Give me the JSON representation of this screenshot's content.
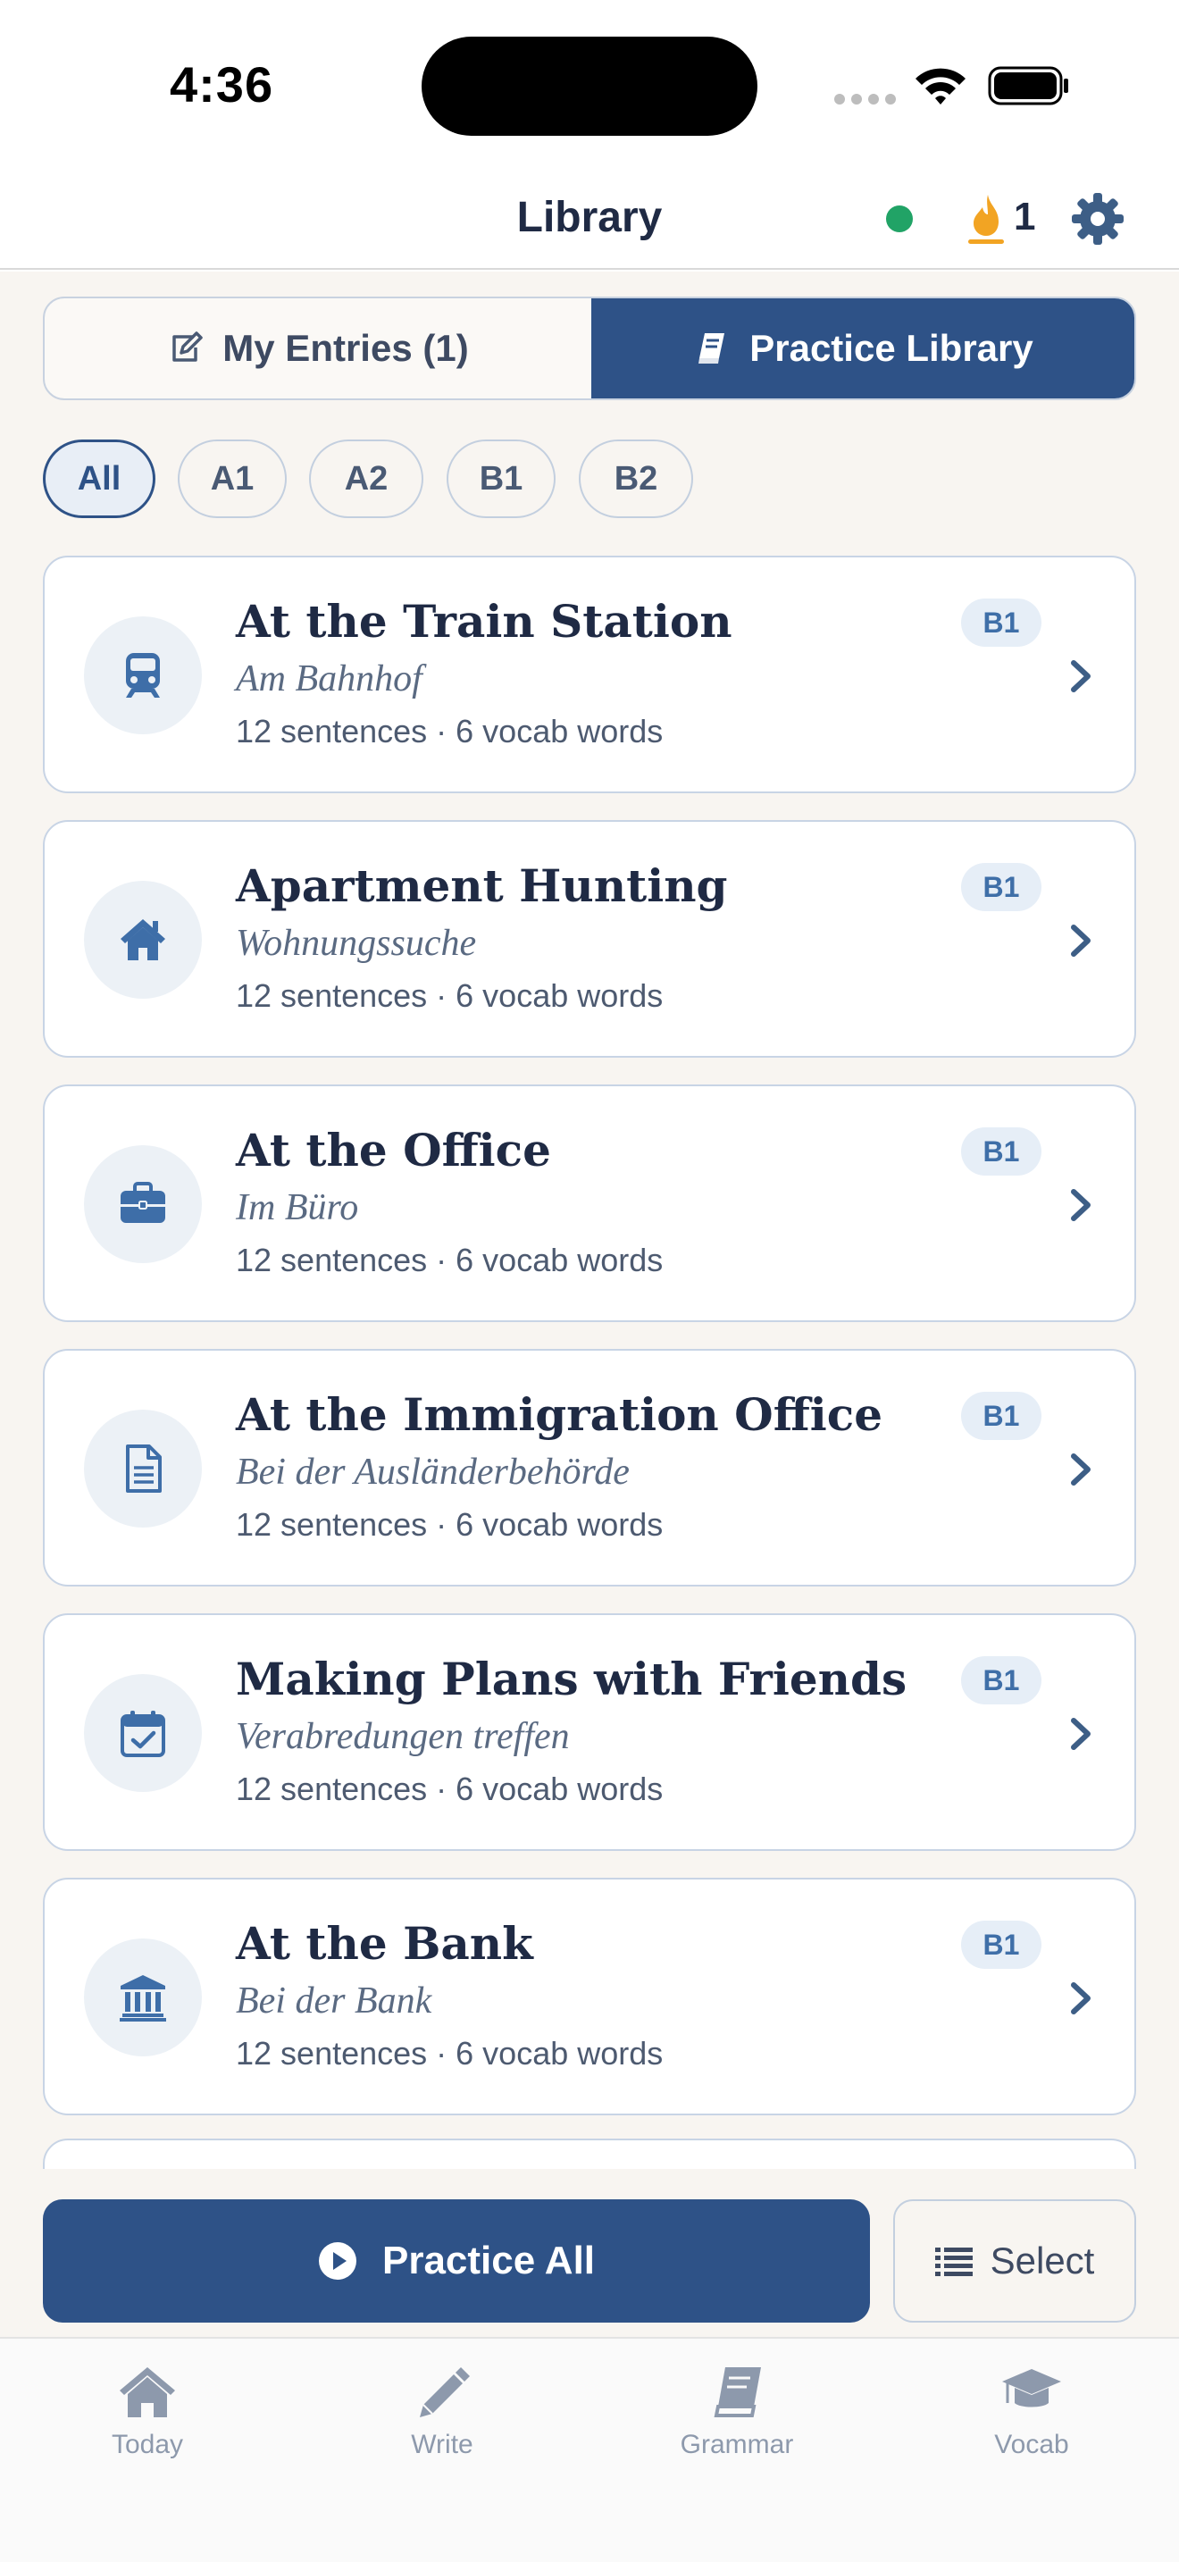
{
  "status_bar": {
    "time": "4:36"
  },
  "header": {
    "title": "Library",
    "streak_count": "1",
    "colors": {
      "online": "#21a366",
      "streak": "#f2a423"
    }
  },
  "segments": {
    "my_entries": "My Entries (1)",
    "practice_library": "Practice Library",
    "active": "practice_library"
  },
  "filters": {
    "active": "All",
    "items": [
      "All",
      "A1",
      "A2",
      "B1",
      "B2"
    ]
  },
  "lessons": [
    {
      "title": "At the Train Station",
      "subtitle": "Am Bahnhof",
      "meta": "12 sentences · 6 vocab words",
      "level": "B1",
      "icon": "train-icon"
    },
    {
      "title": "Apartment Hunting",
      "subtitle": "Wohnungssuche",
      "meta": "12 sentences · 6 vocab words",
      "level": "B1",
      "icon": "house-icon"
    },
    {
      "title": "At the Office",
      "subtitle": "Im Büro",
      "meta": "12 sentences · 6 vocab words",
      "level": "B1",
      "icon": "briefcase-icon"
    },
    {
      "title": "At the Immigration Office",
      "subtitle": "Bei der Ausländerbehörde",
      "meta": "12 sentences · 6 vocab words",
      "level": "B1",
      "icon": "document-icon"
    },
    {
      "title": "Making Plans with Friends",
      "subtitle": "Verabredungen treffen",
      "meta": "12 sentences · 6 vocab words",
      "level": "B1",
      "icon": "calendar-check-icon"
    },
    {
      "title": "At the Bank",
      "subtitle": "Bei der Bank",
      "meta": "12 sentences · 6 vocab words",
      "level": "B1",
      "icon": "bank-icon"
    }
  ],
  "actions": {
    "practice_all": "Practice All",
    "select": "Select"
  },
  "tabs": [
    {
      "label": "Today",
      "icon": "house-icon"
    },
    {
      "label": "Write",
      "icon": "pencil-icon"
    },
    {
      "label": "Grammar",
      "icon": "book-icon"
    },
    {
      "label": "Vocab",
      "icon": "graduation-cap-icon"
    }
  ],
  "colors": {
    "primary": "#2e5287",
    "background": "#f8f5f1",
    "badge_bg": "#e6eef7",
    "badge_text": "#3f6fa8"
  }
}
